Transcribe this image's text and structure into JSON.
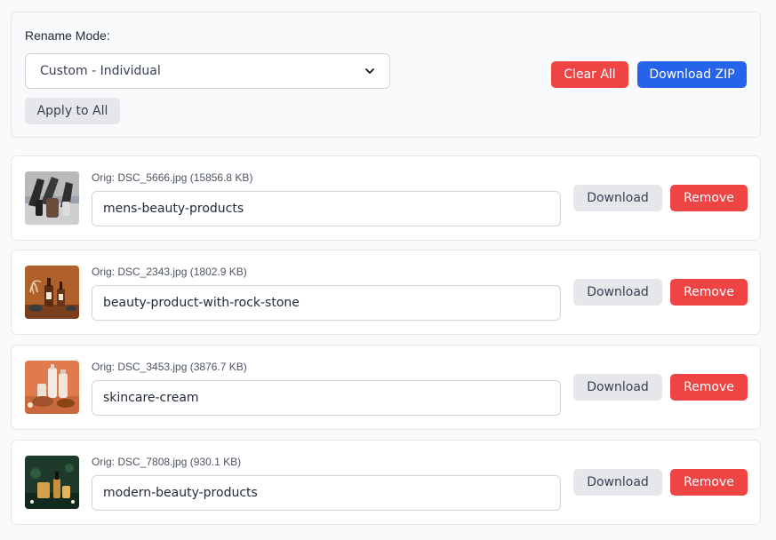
{
  "controls": {
    "rename_mode_label": "Rename Mode:",
    "rename_mode_value": "Custom - Individual",
    "apply_label": "Apply to All",
    "clear_label": "Clear All",
    "zip_label": "Download ZIP"
  },
  "files": [
    {
      "orig": "Orig: DSC_5666.jpg (15856.8 KB)",
      "name": "mens-beauty-products",
      "download": "Download",
      "remove": "Remove"
    },
    {
      "orig": "Orig: DSC_2343.jpg (1802.9 KB)",
      "name": "beauty-product-with-rock-stone",
      "download": "Download",
      "remove": "Remove"
    },
    {
      "orig": "Orig: DSC_3453.jpg (3876.7 KB)",
      "name": "skincare-cream",
      "download": "Download",
      "remove": "Remove"
    },
    {
      "orig": "Orig: DSC_7808.jpg (930.1 KB)",
      "name": "modern-beauty-products",
      "download": "Download",
      "remove": "Remove"
    }
  ],
  "colors": {
    "danger": "#ef4444",
    "primary": "#2563eb",
    "neutral": "#e5e7eb"
  }
}
